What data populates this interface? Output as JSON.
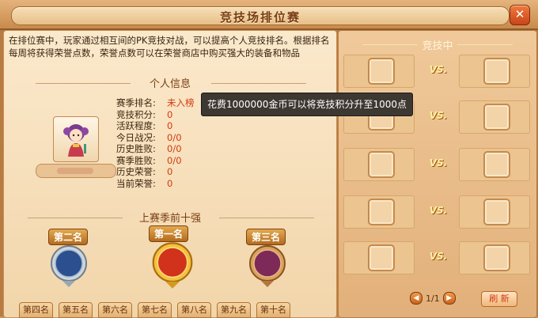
{
  "window": {
    "title": "竞技场排位赛",
    "close_label": "✕"
  },
  "description": "在排位赛中，玩家通过相互间的PK竞技对战，可以提高个人竞技排名。根据排名每周将获得荣誉点数，荣誉点数可以在荣誉商店中购买强大的装备和物品",
  "personal": {
    "heading": "个人信息",
    "stats": [
      {
        "label": "赛季排名:",
        "value": "未入榜"
      },
      {
        "label": "竞技积分:",
        "value": "0"
      },
      {
        "label": "活跃程度:",
        "value": "0"
      },
      {
        "label": "今日战况:",
        "value": "0/0"
      },
      {
        "label": "历史胜败:",
        "value": "0/0"
      },
      {
        "label": "赛季胜败:",
        "value": "0/0"
      },
      {
        "label": "历史荣誉:",
        "value": "0"
      },
      {
        "label": "当前荣誉:",
        "value": "0"
      }
    ]
  },
  "tooltip": "花费1000000金币可以将竞技积分升至1000点",
  "top_ten": {
    "heading": "上赛季前十强",
    "medals": [
      {
        "label": "第二名",
        "color": "#2b4f8f"
      },
      {
        "label": "第一名",
        "color": "#d0321c"
      },
      {
        "label": "第三名",
        "color": "#7d2a58"
      }
    ],
    "ranks": [
      "第四名",
      "第五名",
      "第六名",
      "第七名",
      "第八名",
      "第九名",
      "第十名"
    ]
  },
  "battle": {
    "heading": "竞技中",
    "vs_label": "VS.",
    "matches": 5,
    "page": "1/1",
    "prev_label": "◀",
    "next_label": "▶",
    "refresh_label": "刷 新"
  }
}
